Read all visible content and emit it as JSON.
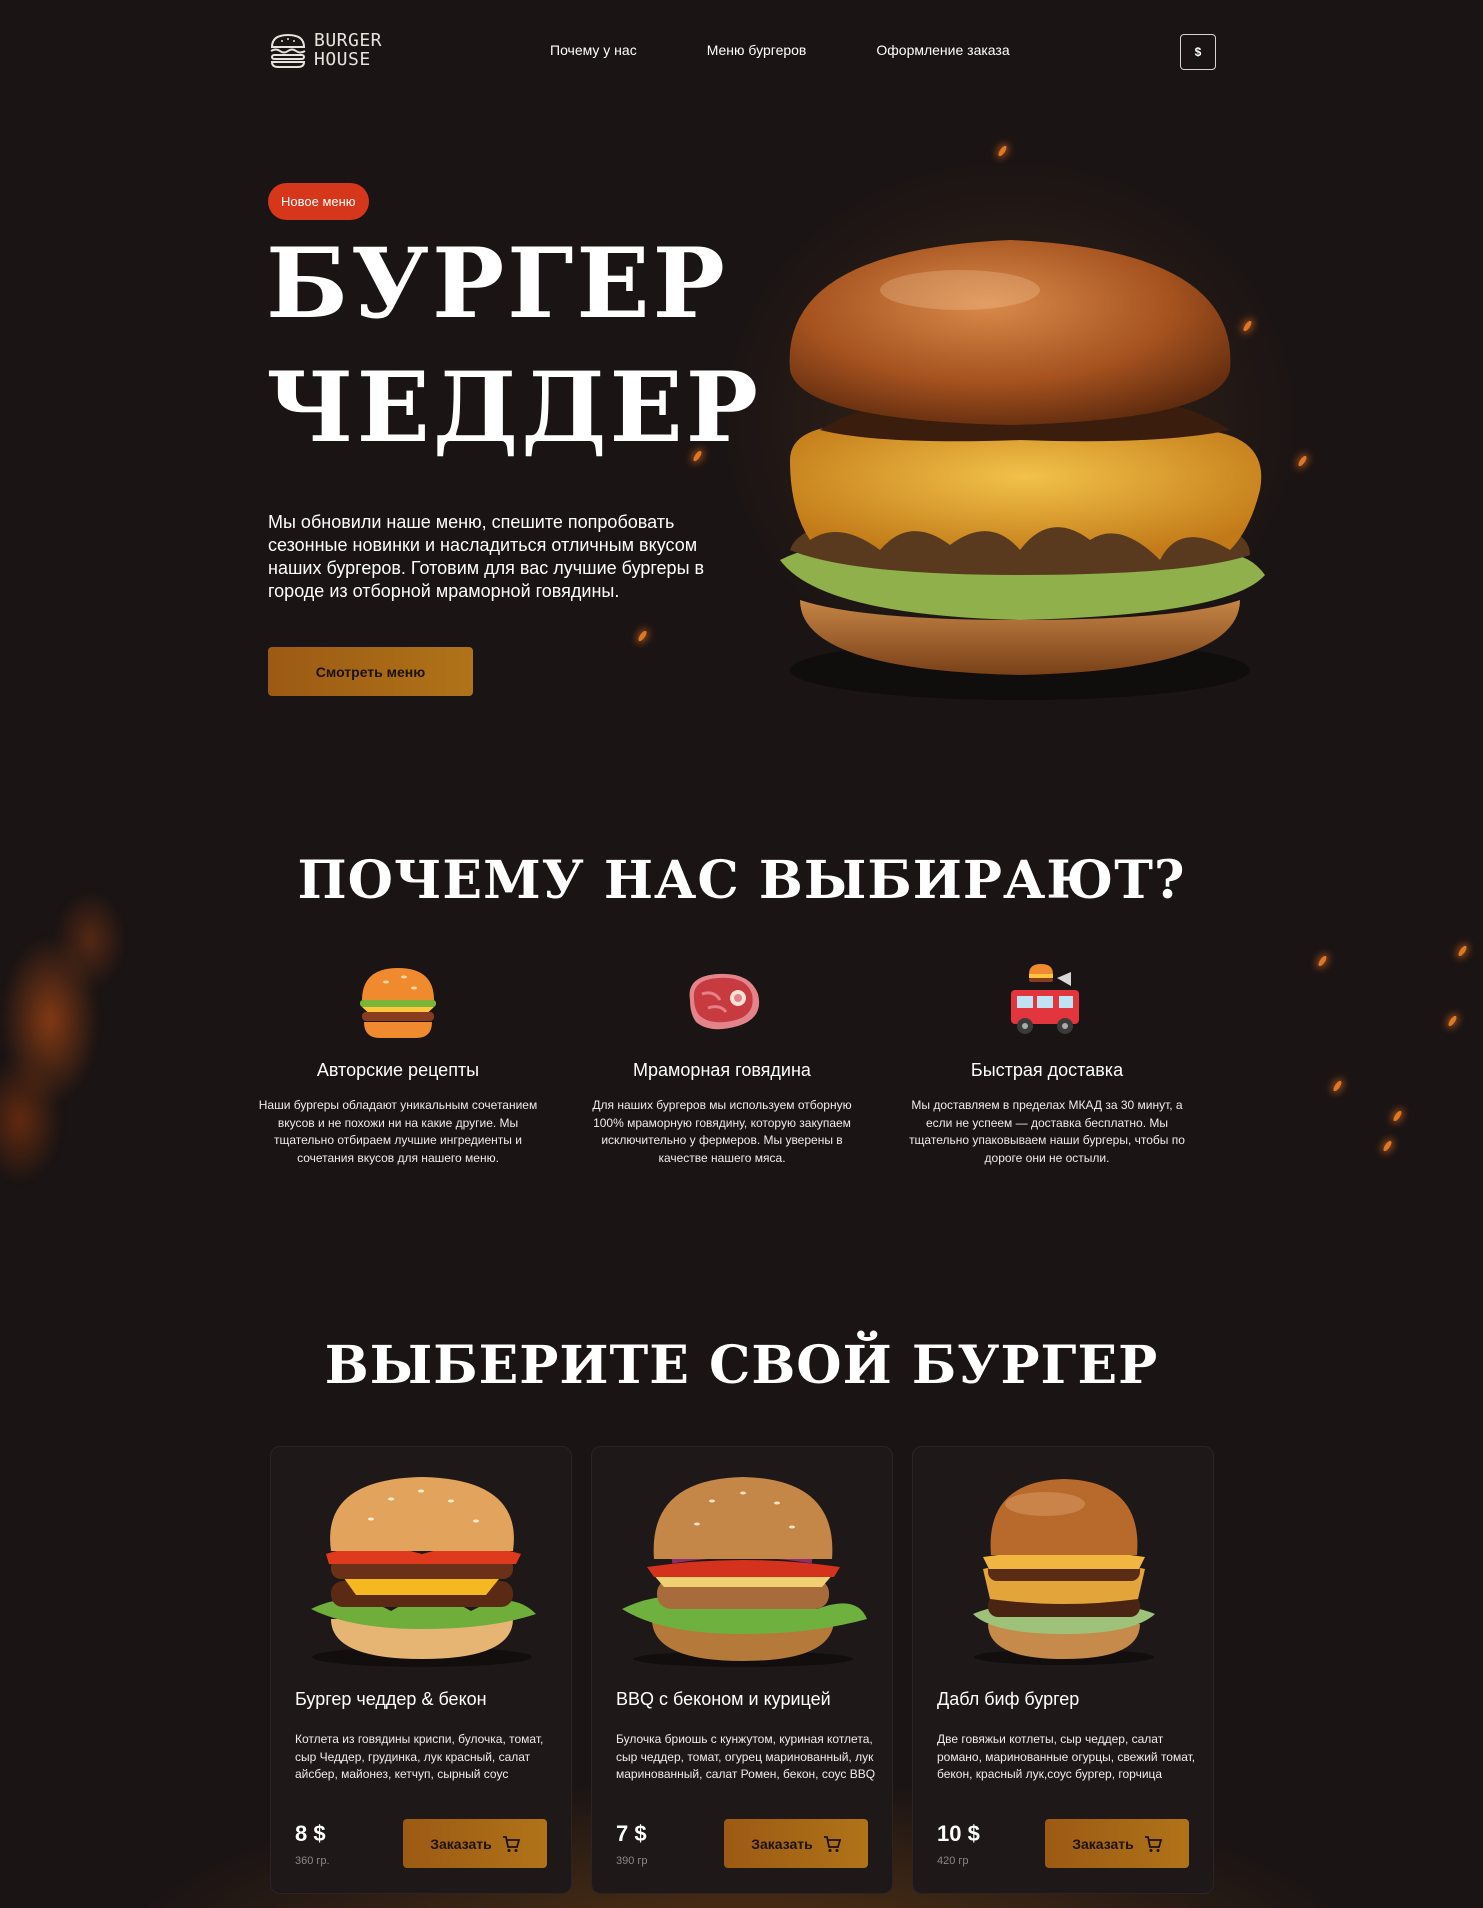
{
  "header": {
    "logo_line1": "BURGER",
    "logo_line2": "HOUSE",
    "nav": [
      "Почему у нас",
      "Меню бургеров",
      "Оформление заказа"
    ],
    "currency_label": "$"
  },
  "hero": {
    "badge": "Новое меню",
    "title_line1": "БУРГЕР",
    "title_line2": "ЧЕДДЕР",
    "text": "Мы обновили наше меню, спешите попробовать сезонные новинки и насладиться отличным вкусом наших бургеров. Готовим для вас лучшие бургеры в городе из отборной мраморной говядины.",
    "button": "Смотреть меню"
  },
  "why": {
    "title": "ПОЧЕМУ НАС ВЫБИРАЮТ?",
    "items": [
      {
        "icon": "burger-icon",
        "title": "Авторские рецепты",
        "text": "Наши бургеры обладают уникальным сочетанием вкусов и не похожи ни на какие другие. Мы тщательно отбираем лучшие ингредиенты и сочетания вкусов для нашего меню."
      },
      {
        "icon": "meat-icon",
        "title": "Мраморная говядина",
        "text": "Для наших бургеров мы используем отборную 100% мраморную говядину, которую закупаем исключительно у фермеров. Мы уверены в качестве нашего мяса."
      },
      {
        "icon": "food-truck-icon",
        "title": "Быстрая доставка",
        "text": "Мы доставляем в пределах МКАД за 30 минут, а если не успеем — доставка бесплатно. Мы тщательно упаковываем наши бургеры, чтобы по дороге они не остыли."
      }
    ]
  },
  "menu": {
    "title": "ВЫБЕРИТЕ СВОЙ БУРГЕР",
    "cards": [
      {
        "title": "Бургер чеддер & бекон",
        "desc": "Котлета из говядины криспи, булочка, томат, сыр Чеддер, грудинка, лук красный, салат айсбер, майонез, кетчуп, сырный соус",
        "price": "8 $",
        "weight": "360 гр.",
        "button": "Заказать"
      },
      {
        "title": "BBQ с беконом и курицей",
        "desc": "Булочка бриошь с кунжутом, куриная котлета, сыр чеддер, томат, огурец маринованный, лук маринованный, салат Ромен, бекон, соус BBQ",
        "price": "7 $",
        "weight": "390 гр",
        "button": "Заказать"
      },
      {
        "title": "Дабл биф бургер",
        "desc": "Две говяжьи котлеты, сыр чеддер, салат романо, маринованные огурцы, свежий томат, бекон, красный лук,соус бургер, горчица",
        "price": "10 $",
        "weight": "420 гр",
        "button": "Заказать"
      }
    ]
  },
  "colors": {
    "background": "#1a1414",
    "accent_red": "#d6361a",
    "button_gold": "#b07318",
    "card_bg": "#1f1818"
  }
}
